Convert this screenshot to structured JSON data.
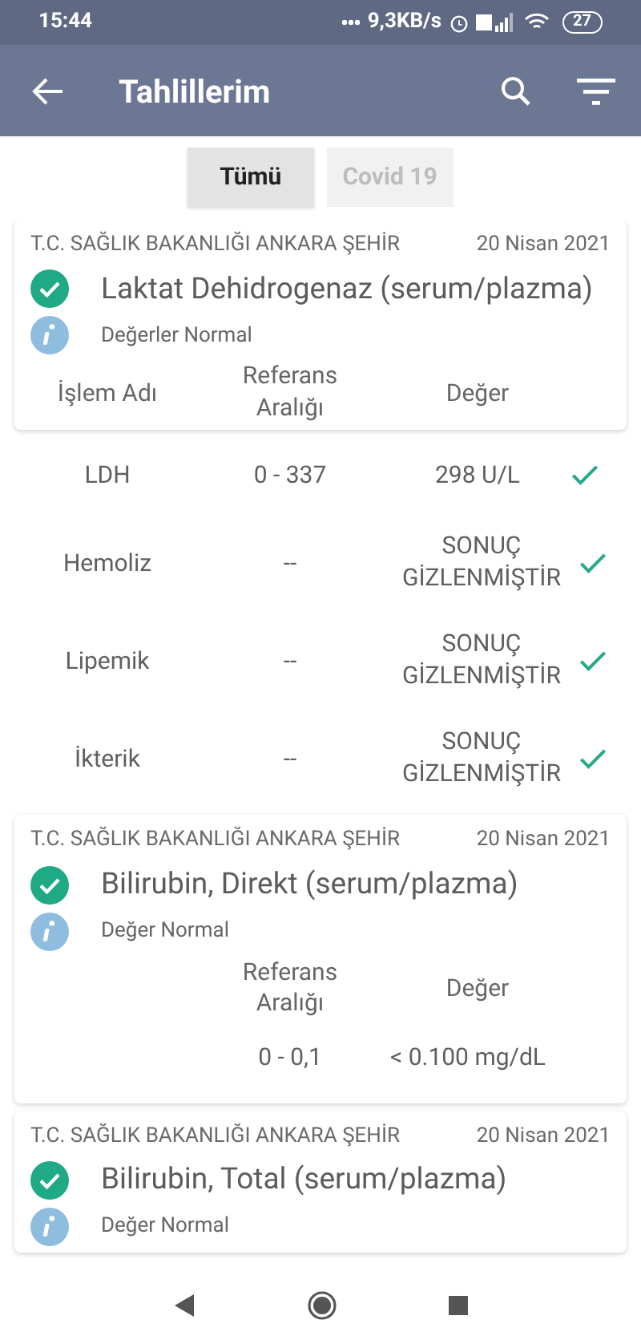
{
  "status_bar": {
    "time": "15:44",
    "speed": "9,3KB/s",
    "battery": "27"
  },
  "app_bar": {
    "title": "Tahlillerim"
  },
  "tabs": [
    {
      "label": "Tümü",
      "selected": true
    },
    {
      "label": "Covid 19",
      "selected": false
    }
  ],
  "results": [
    {
      "source": "T.C. SAĞLIK BAKANLIĞI ANKARA ŞEHİR",
      "date": "20 Nisan 2021",
      "title": "Laktat Dehidrogenaz (serum/plazma)",
      "status": "Değerler Normal",
      "kind": "expanded",
      "columns": {
        "name": "İşlem Adı",
        "range": "Referans Aralığı",
        "value": "Değer"
      },
      "rows": [
        {
          "name": "LDH",
          "range": "0 - 337",
          "value": "298 U/L",
          "verified": true
        },
        {
          "name": "Hemoliz",
          "range": "--",
          "value": "SONUÇ GİZLENMİŞTİR",
          "verified": true
        },
        {
          "name": "Lipemik",
          "range": "--",
          "value": "SONUÇ GİZLENMİŞTİR",
          "verified": true
        },
        {
          "name": "İkterik",
          "range": "--",
          "value": "SONUÇ GİZLENMİŞTİR",
          "verified": true
        }
      ]
    },
    {
      "source": "T.C. SAĞLIK BAKANLIĞI ANKARA ŞEHİR",
      "date": "20 Nisan 2021",
      "title": "Bilirubin, Direkt (serum/plazma)",
      "status": "Değer Normal",
      "kind": "compact",
      "columns": {
        "range": "Referans Aralığı",
        "value": "Değer"
      },
      "rows": [
        {
          "range": "0 - 0,1",
          "value": "< 0.100 mg/dL"
        }
      ]
    },
    {
      "source": "T.C. SAĞLIK BAKANLIĞI ANKARA ŞEHİR",
      "date": "20 Nisan 2021",
      "title": "Bilirubin, Total (serum/plazma)",
      "status": "Değer Normal",
      "kind": "compact"
    }
  ]
}
